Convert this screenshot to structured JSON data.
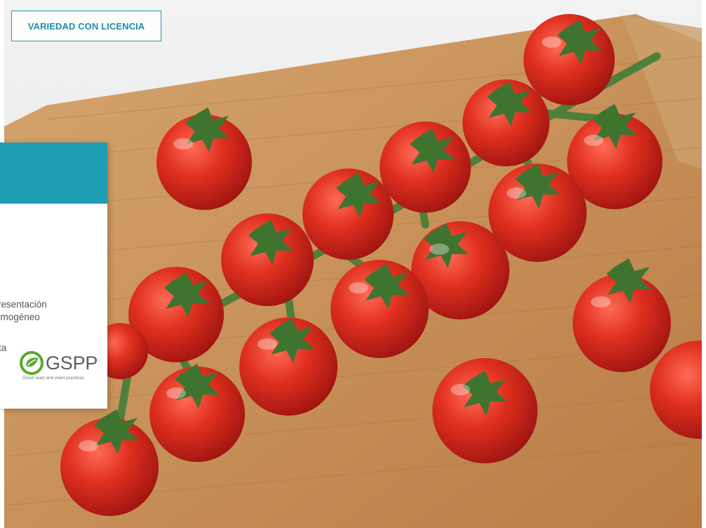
{
  "badge": {
    "label": "VARIEDAD CON LICENCIA"
  },
  "card": {
    "description_lines": [
      "resentación",
      "omogéneo"
    ],
    "fragment": "ta"
  },
  "logo": {
    "name": "GSPP",
    "tagline": "Good seed and plant practices"
  },
  "colors": {
    "teal": "#1f9db3",
    "tomato": "#d8261c",
    "wood": "#c8915a",
    "stem": "#4f7f3a"
  }
}
